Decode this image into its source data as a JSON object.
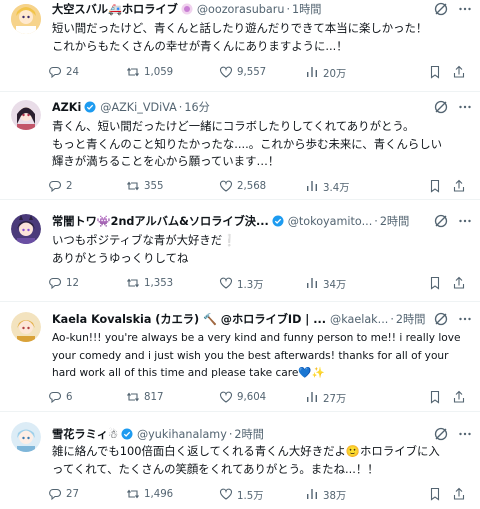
{
  "tweets": [
    {
      "name": "大空スバル🚑ホロライブ",
      "handle": "@oozorasubaru",
      "time": "1時間",
      "lines": [
        "短い間だったけど、青くんと話したり遊んだりできて本当に楽しかった！",
        "これからもたくさんの幸せが青くんにありますように...！"
      ],
      "replies": "24",
      "retweets": "1,059",
      "likes": "9,557",
      "views": "20万",
      "avatar_color": "#f2c44a"
    },
    {
      "name": "AZKi",
      "handle": "@AZKi_VDiVA",
      "time": "16分",
      "lines": [
        "青くん、短い間だったけど一緒にコラボしたりしてくれてありがとう。",
        "もっと青くんのこと知りたかったな....。これから歩む未来に、青くんらしい",
        "輝きが満ちることを心から願っています…！"
      ],
      "replies": "2",
      "retweets": "355",
      "likes": "2,568",
      "views": "3.4万",
      "avatar_color": "#c2566a"
    },
    {
      "name": "常闇トワ👾2ndアルバム&ソロライブ決...",
      "handle": "@tokoyamito...",
      "time": "2時間",
      "lines": [
        "いつもポジティブな青が大好きだ❕",
        "ありがとうゆっくりしてね"
      ],
      "replies": "12",
      "retweets": "1,353",
      "likes": "1.3万",
      "views": "34万",
      "avatar_color": "#6a4fa3"
    },
    {
      "name": "Kaela Kovalskia (カエラ) 🔨 @ホロライブID | ...",
      "handle": "@kaelak...",
      "time": "2時間",
      "lines": [
        "Ao-kun!!! you're always be a very kind and funny person to me!! i really love",
        "your comedy and i just wish you the best afterwards! thanks for all of your",
        "hard work all of this time and please take care💙✨"
      ],
      "replies": "6",
      "retweets": "817",
      "likes": "9,604",
      "views": "27万",
      "avatar_color": "#d9a23a"
    },
    {
      "name": "雪花ラミィ☃",
      "handle": "@yukihanalamy",
      "time": "2時間",
      "lines": [
        "雑に絡んでも100倍面白く返してくれる青くん大好きだよ🙂ホロライブに入",
        "ってくれて、たくさんの笑顔をくれてありがとう。またね...！！"
      ],
      "replies": "27",
      "retweets": "1,496",
      "likes": "1.5万",
      "views": "38万",
      "avatar_color": "#7fb6d9"
    }
  ],
  "colors": {
    "verified": "#1d9bf0",
    "muted": "#536471",
    "text": "#0f1419"
  }
}
